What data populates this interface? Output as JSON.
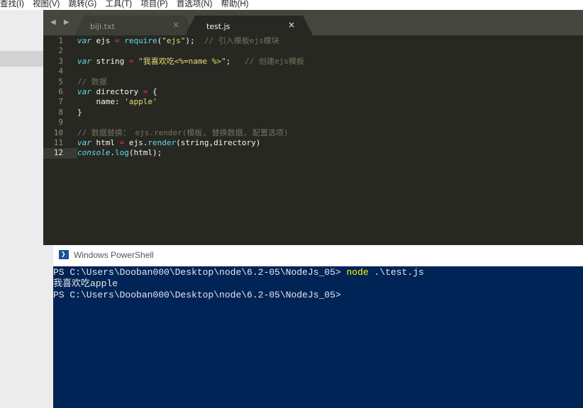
{
  "menu": [
    "查找(I)",
    "视图(V)",
    "跳转(G)",
    "工具(T)",
    "项目(P)",
    "首选项(N)",
    "帮助(H)"
  ],
  "tabs": [
    {
      "label": "biji.txt",
      "close": "×"
    },
    {
      "label": "test.js",
      "close": "×"
    }
  ],
  "nav_arrows": "◀ ▶",
  "editor": {
    "current_line": 12,
    "lines": [
      {
        "n": "1",
        "tokens": [
          {
            "t": "kw",
            "v": "var"
          },
          {
            "t": "pl",
            "v": " ejs "
          },
          {
            "t": "op",
            "v": "="
          },
          {
            "t": "pl",
            "v": " "
          },
          {
            "t": "fn",
            "v": "require"
          },
          {
            "t": "pl",
            "v": "("
          },
          {
            "t": "st",
            "v": "\"ejs\""
          },
          {
            "t": "pl",
            "v": ");  "
          },
          {
            "t": "cm",
            "v": "// 引入模板ejs模块"
          }
        ]
      },
      {
        "n": "2",
        "tokens": []
      },
      {
        "n": "3",
        "tokens": [
          {
            "t": "kw",
            "v": "var"
          },
          {
            "t": "pl",
            "v": " string "
          },
          {
            "t": "op",
            "v": "="
          },
          {
            "t": "pl",
            "v": " "
          },
          {
            "t": "st",
            "v": "\"我喜欢吃<%=name %>\""
          },
          {
            "t": "pl",
            "v": ";   "
          },
          {
            "t": "cm",
            "v": "// 创建ejs模板"
          }
        ]
      },
      {
        "n": "4",
        "tokens": []
      },
      {
        "n": "5",
        "tokens": [
          {
            "t": "cm",
            "v": "// 数据"
          }
        ]
      },
      {
        "n": "6",
        "tokens": [
          {
            "t": "kw",
            "v": "var"
          },
          {
            "t": "pl",
            "v": " directory "
          },
          {
            "t": "op",
            "v": "="
          },
          {
            "t": "pl",
            "v": " {"
          }
        ]
      },
      {
        "n": "7",
        "tokens": [
          {
            "t": "pl",
            "v": "    name: "
          },
          {
            "t": "st",
            "v": "'apple'"
          }
        ]
      },
      {
        "n": "8",
        "tokens": [
          {
            "t": "pl",
            "v": "}"
          }
        ]
      },
      {
        "n": "9",
        "tokens": []
      },
      {
        "n": "10",
        "tokens": [
          {
            "t": "cm",
            "v": "// 数据替换： ejs.render(模板, 替换数据, 配置选项)"
          }
        ]
      },
      {
        "n": "11",
        "tokens": [
          {
            "t": "kw",
            "v": "var"
          },
          {
            "t": "pl",
            "v": " html "
          },
          {
            "t": "op",
            "v": "="
          },
          {
            "t": "pl",
            "v": " ejs."
          },
          {
            "t": "fn",
            "v": "render"
          },
          {
            "t": "pl",
            "v": "(string,directory)"
          }
        ]
      },
      {
        "n": "12",
        "tokens": [
          {
            "t": "kw",
            "v": "console"
          },
          {
            "t": "pl",
            "v": "."
          },
          {
            "t": "fn",
            "v": "log"
          },
          {
            "t": "pl",
            "v": "(html);"
          }
        ]
      }
    ]
  },
  "powershell": {
    "title": "Windows PowerShell",
    "icon_glyph": "❯",
    "prompt1": "PS C:\\Users\\Dooban000\\Desktop\\node\\6.2-05\\NodeJs_05> ",
    "command": "node",
    "args": " .\\test.js",
    "output": "我喜欢吃apple",
    "prompt2": "PS C:\\Users\\Dooban000\\Desktop\\node\\6.2-05\\NodeJs_05>"
  }
}
